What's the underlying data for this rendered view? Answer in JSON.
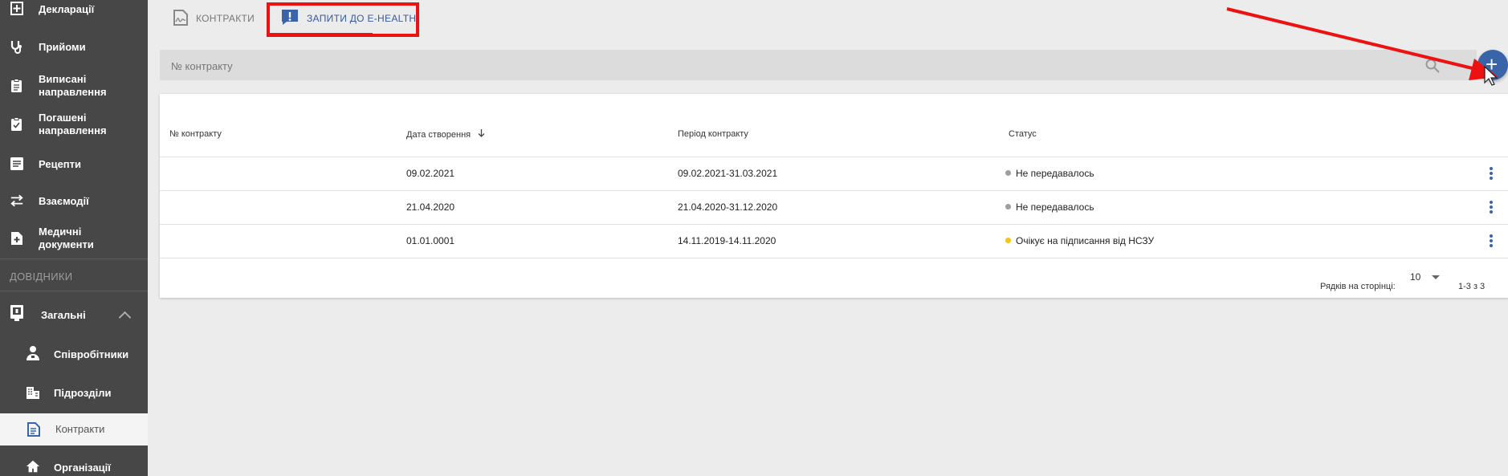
{
  "sidebar": {
    "items": [
      {
        "label": "Декларації",
        "icon": "declaration-plus-icon"
      },
      {
        "label": "Прийоми",
        "icon": "stethoscope-icon"
      },
      {
        "label": "Виписані направлення",
        "icon": "referral-issued-icon"
      },
      {
        "label": "Погашені направлення",
        "icon": "referral-redeemed-icon"
      },
      {
        "label": "Рецепти",
        "icon": "prescription-list-icon"
      },
      {
        "label": "Взаємодії",
        "icon": "swap-arrows-icon"
      },
      {
        "label": "Медичні документи",
        "icon": "medical-document-icon"
      }
    ],
    "section_header": "ДОВІДНИКИ",
    "group": {
      "label": "Загальні",
      "icon": "general-reference-icon"
    },
    "sub_items": [
      {
        "label": "Співробітники",
        "icon": "employee-icon"
      },
      {
        "label": "Підрозділи",
        "icon": "division-building-icon"
      },
      {
        "label": "Контракти",
        "icon": "contract-document-icon"
      },
      {
        "label": "Організації",
        "icon": "organization-home-icon"
      }
    ]
  },
  "tabs": [
    {
      "label": "КОНТРАКТИ",
      "icon": "contract-signature-icon"
    },
    {
      "label": "ЗАПИТИ ДО E-HEALTH",
      "icon": "request-alert-icon"
    }
  ],
  "search": {
    "placeholder": "№ контракту"
  },
  "fab": {
    "label": "+"
  },
  "table": {
    "headers": [
      "№ контракту",
      "Дата створення",
      "Період контракту",
      "Статус"
    ],
    "rows": [
      {
        "number": "",
        "created": "09.02.2021",
        "period": "09.02.2021-31.03.2021",
        "status": "Не передавалось",
        "status_color": "#9e9e9e"
      },
      {
        "number": "",
        "created": "21.04.2020",
        "period": "21.04.2020-31.12.2020",
        "status": "Не передавалось",
        "status_color": "#9e9e9e"
      },
      {
        "number": "",
        "created": "01.01.0001",
        "period": "14.11.2019-14.11.2020",
        "status": "Очікує на підписання від НСЗУ",
        "status_color": "#f5c518"
      }
    ]
  },
  "pagination": {
    "rows_per_page_label": "Рядків на сторінці:",
    "rows_per_page": "10",
    "range": "1-3 з 3"
  },
  "colors": {
    "sidebar_bg": "#474747",
    "accent": "#3a64a8",
    "annotation": "#e11111"
  }
}
